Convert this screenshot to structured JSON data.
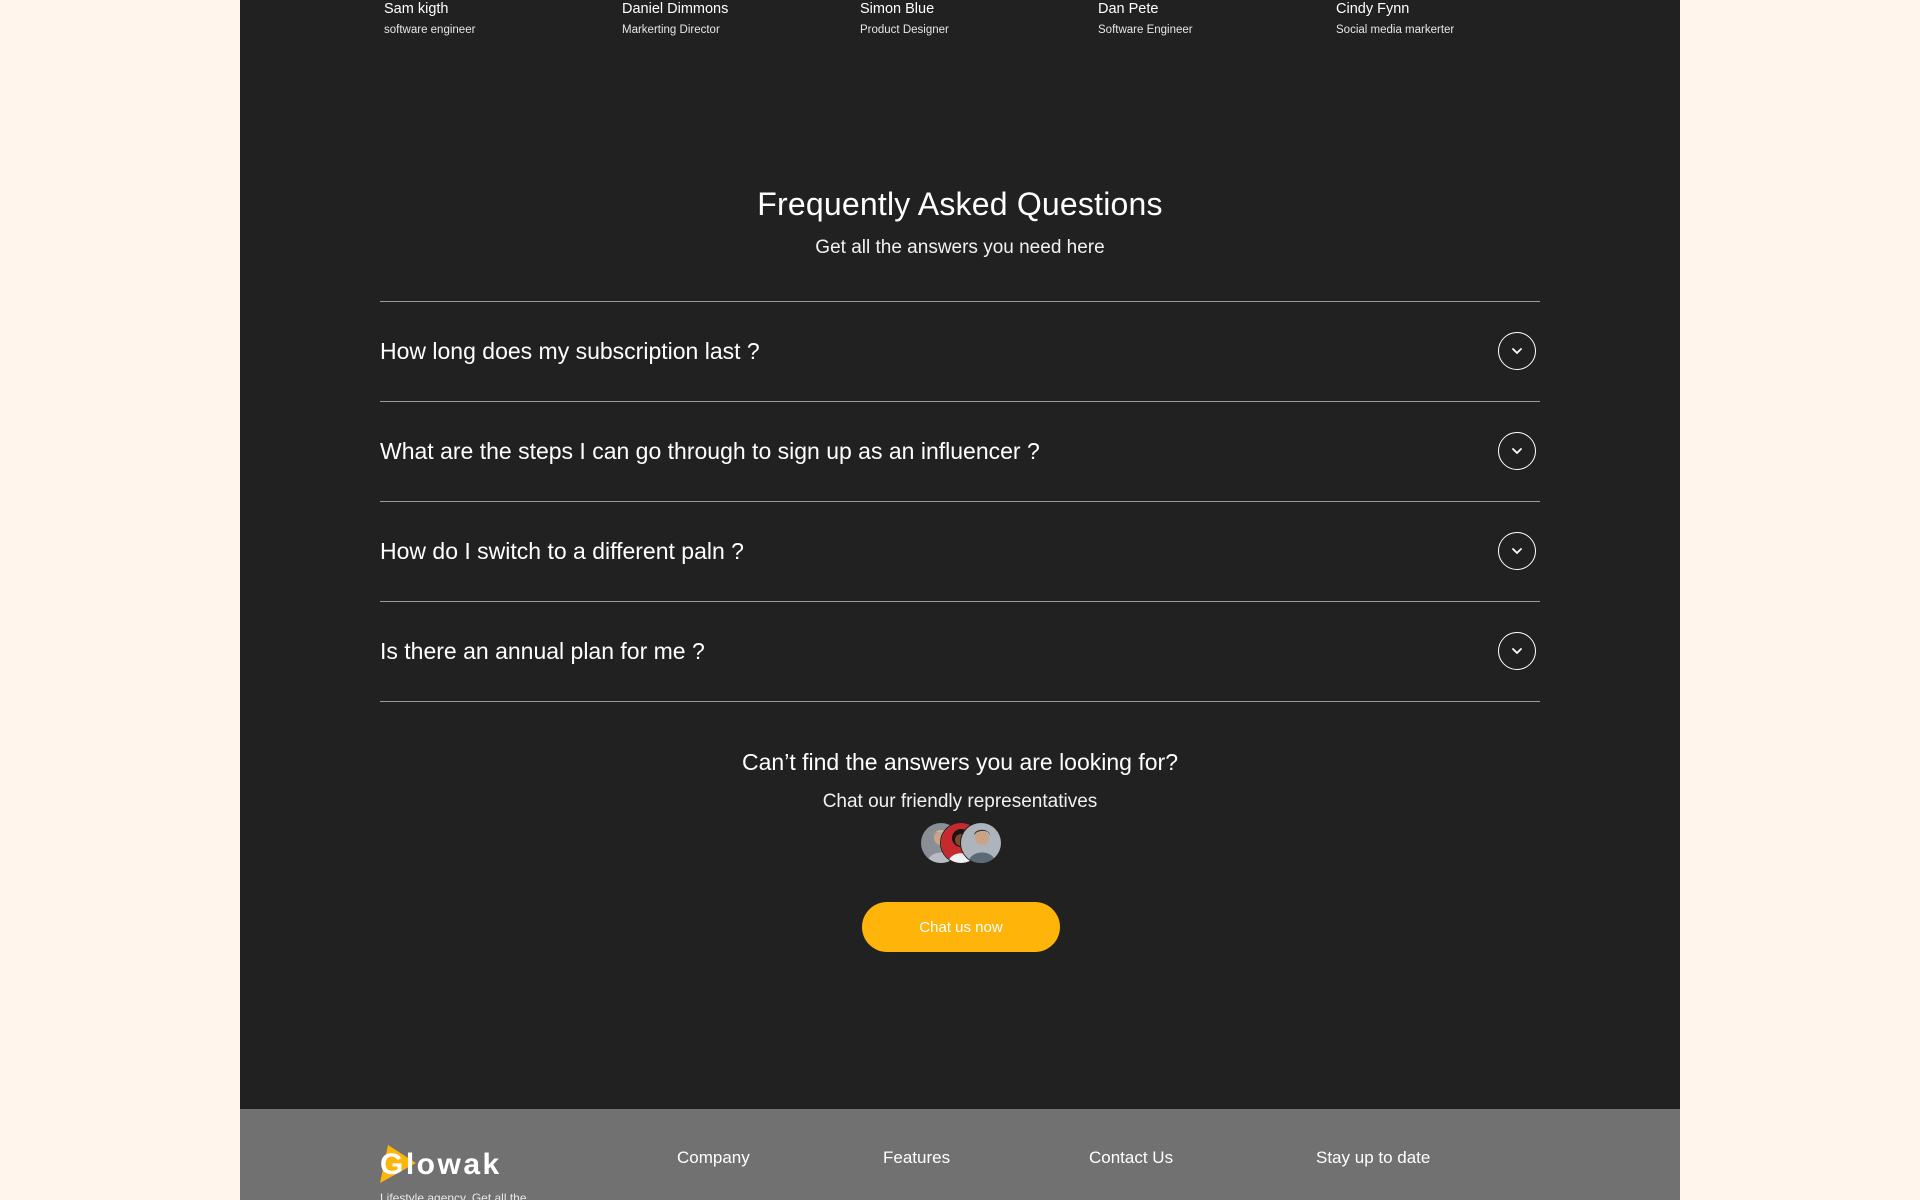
{
  "team": {
    "members": [
      {
        "name": "Sam kigth",
        "role": "software engineer"
      },
      {
        "name": "Daniel Dimmons",
        "role": "Markerting Director"
      },
      {
        "name": "Simon Blue",
        "role": "Product Designer"
      },
      {
        "name": "Dan Pete",
        "role": "Software Engineer"
      },
      {
        "name": "Cindy Fynn",
        "role": "Social media markerter"
      }
    ]
  },
  "faq": {
    "title": "Frequently Asked Questions",
    "subtitle": "Get all the answers you need here",
    "items": [
      {
        "question": "How long does my subscription last ?",
        "icon": "chevron-down-icon"
      },
      {
        "question": "What are the steps I can go through to sign up as an influencer ?",
        "icon": "chevron-down-icon"
      },
      {
        "question": "How do I switch to a different paln ?",
        "icon": "chevron-down-icon"
      },
      {
        "question": "Is there an annual plan for me ?",
        "icon": "chevron-down-icon"
      }
    ]
  },
  "help": {
    "title": "Can’t find the answers you are looking for?",
    "subtitle": "Chat our friendly representatives",
    "button_label": "Chat us now"
  },
  "footer": {
    "logo_text": "Glowak",
    "tagline": "Lifestyle agency. Get all the",
    "columns": [
      "Company",
      "Features",
      "Contact Us",
      "Stay up to date"
    ]
  },
  "colors": {
    "page_background": "#fff5ec",
    "section_background": "#212121",
    "footer_background": "#717171",
    "accent": "#ffb40a"
  }
}
